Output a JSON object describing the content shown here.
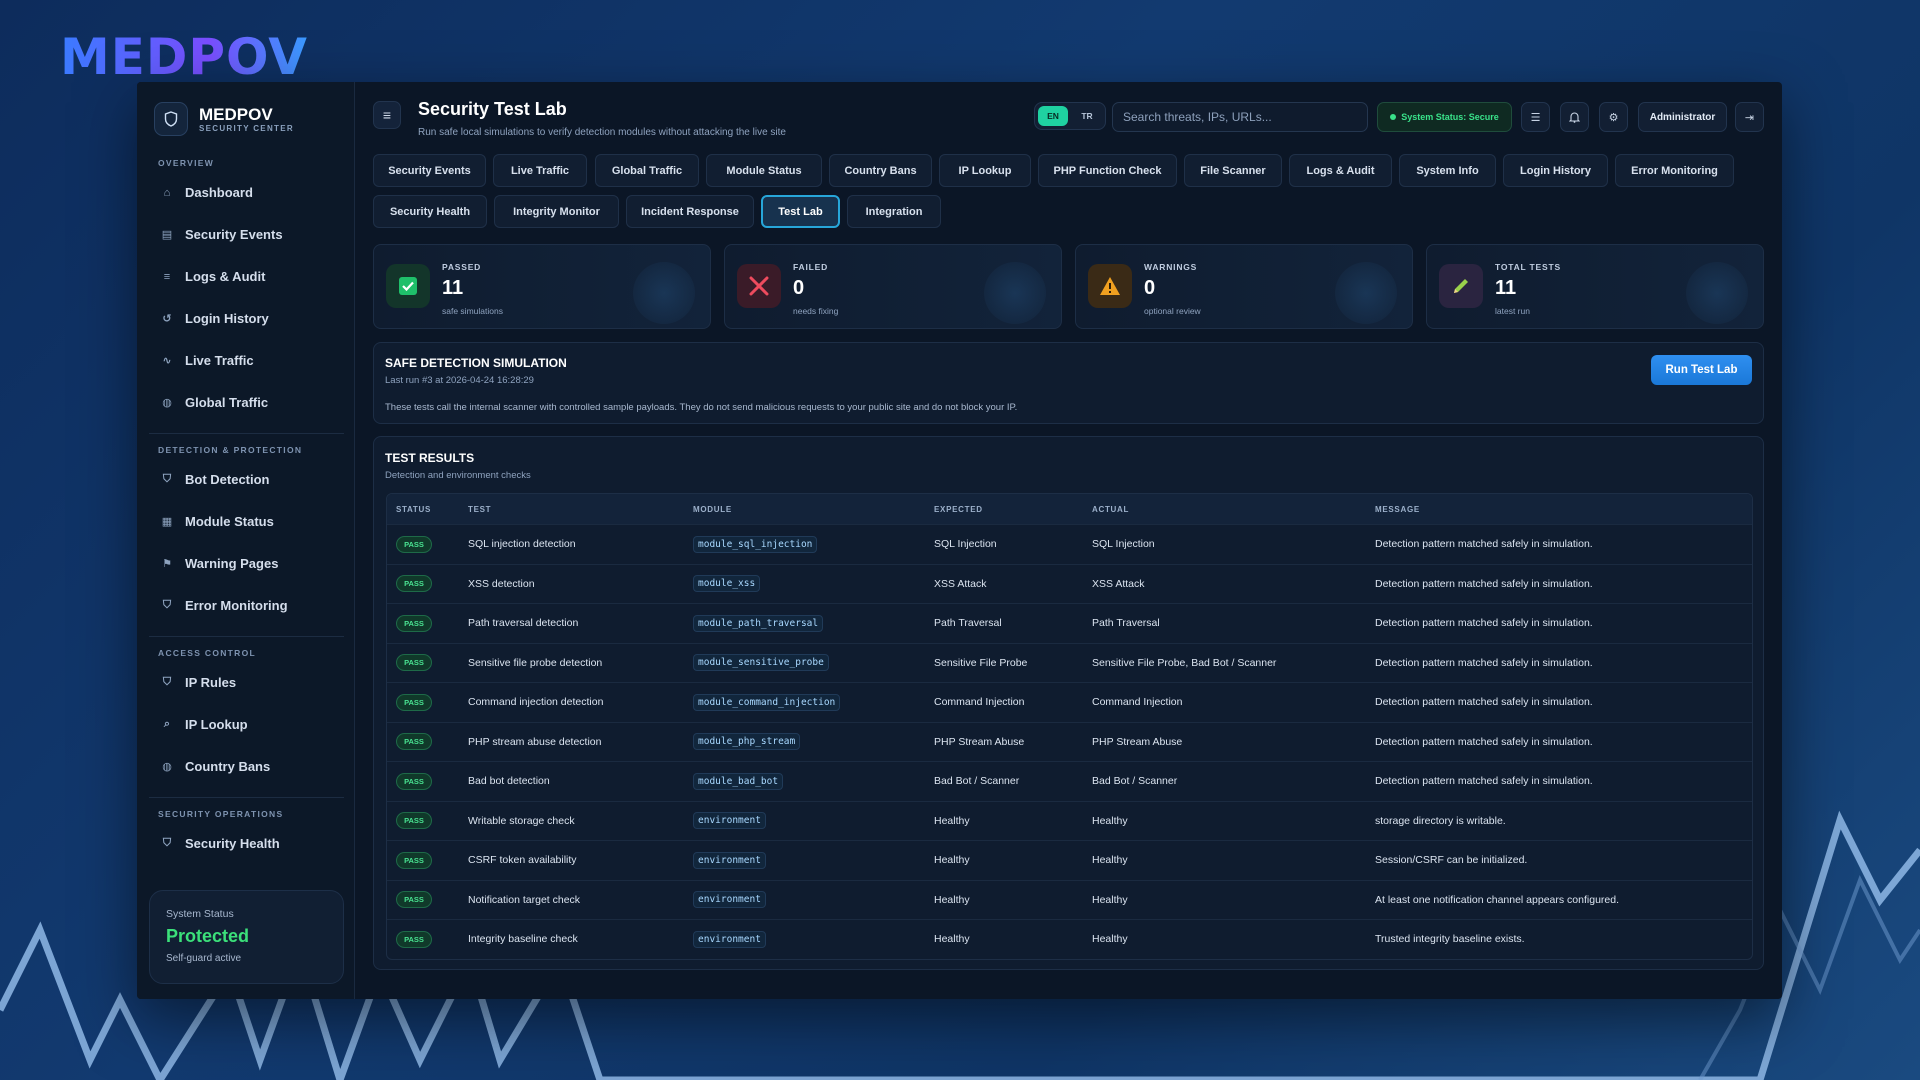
{
  "brand": {
    "logo_text": "MEDPOV",
    "name": "MEDPOV",
    "subtitle": "SECURITY CENTER"
  },
  "sidebar": {
    "sections": [
      {
        "title": "OVERVIEW"
      },
      {
        "title": "DETECTION & PROTECTION"
      },
      {
        "title": "ACCESS CONTROL"
      },
      {
        "title": "SECURITY OPERATIONS"
      }
    ],
    "items": [
      {
        "label": "Dashboard",
        "icon": "home-icon"
      },
      {
        "label": "Security Events",
        "icon": "list-icon"
      },
      {
        "label": "Logs & Audit",
        "icon": "lines-icon"
      },
      {
        "label": "Login History",
        "icon": "history-icon"
      },
      {
        "label": "Live Traffic",
        "icon": "pulse-icon"
      },
      {
        "label": "Global Traffic",
        "icon": "globe-icon"
      },
      {
        "label": "Bot Detection",
        "icon": "shield-icon"
      },
      {
        "label": "Module Status",
        "icon": "grid-icon"
      },
      {
        "label": "Warning Pages",
        "icon": "flag-icon"
      },
      {
        "label": "Error Monitoring",
        "icon": "shield-icon"
      },
      {
        "label": "IP Rules",
        "icon": "shield-icon"
      },
      {
        "label": "IP Lookup",
        "icon": "search-icon"
      },
      {
        "label": "Country Bans",
        "icon": "globe-icon"
      },
      {
        "label": "Security Health",
        "icon": "shield-icon"
      }
    ],
    "status_card": {
      "label": "System Status",
      "value": "Protected",
      "sub": "Self-guard active"
    }
  },
  "header": {
    "title": "Security Test Lab",
    "subtitle": "Run safe local simulations to verify detection modules without attacking the live site",
    "lang_en": "EN",
    "lang_tr": "TR",
    "search_placeholder": "Search threats, IPs, URLs...",
    "system_status": "System Status: Secure",
    "admin_label": "Administrator"
  },
  "tabs": [
    "Security Events",
    "Live Traffic",
    "Global Traffic",
    "Module Status",
    "Country Bans",
    "IP Lookup",
    "PHP Function Check",
    "File Scanner",
    "Logs & Audit",
    "System Info",
    "Login History",
    "Error Monitoring",
    "Security Health",
    "Integrity Monitor",
    "Incident Response",
    "Test Lab",
    "Integration"
  ],
  "active_tab": "Test Lab",
  "stats": [
    {
      "label": "PASSED",
      "value": "11",
      "sub": "safe simulations",
      "icon": "check-icon",
      "color": "#1fbf6a"
    },
    {
      "label": "FAILED",
      "value": "0",
      "sub": "needs fixing",
      "icon": "x-icon",
      "color": "#e84a5f"
    },
    {
      "label": "WARNINGS",
      "value": "0",
      "sub": "optional review",
      "icon": "warning-icon",
      "color": "#f0a020"
    },
    {
      "label": "TOTAL TESTS",
      "value": "11",
      "sub": "latest run",
      "icon": "pencil-icon",
      "color": "#9ad14b"
    }
  ],
  "simulation": {
    "title": "SAFE DETECTION SIMULATION",
    "last_run": "Last run #3 at 2026-04-24 16:28:29",
    "description": "These tests call the internal scanner with controlled sample payloads. They do not send malicious requests to your public site and do not block your IP.",
    "run_button": "Run Test Lab"
  },
  "results": {
    "title": "TEST RESULTS",
    "subtitle": "Detection and environment checks",
    "columns": [
      "STATUS",
      "TEST",
      "MODULE",
      "EXPECTED",
      "ACTUAL",
      "MESSAGE"
    ],
    "rows": [
      {
        "status": "PASS",
        "test": "SQL injection detection",
        "module": "module_sql_injection",
        "expected": "SQL Injection",
        "actual": "SQL Injection",
        "message": "Detection pattern matched safely in simulation."
      },
      {
        "status": "PASS",
        "test": "XSS detection",
        "module": "module_xss",
        "expected": "XSS Attack",
        "actual": "XSS Attack",
        "message": "Detection pattern matched safely in simulation."
      },
      {
        "status": "PASS",
        "test": "Path traversal detection",
        "module": "module_path_traversal",
        "expected": "Path Traversal",
        "actual": "Path Traversal",
        "message": "Detection pattern matched safely in simulation."
      },
      {
        "status": "PASS",
        "test": "Sensitive file probe detection",
        "module": "module_sensitive_probe",
        "expected": "Sensitive File Probe",
        "actual": "Sensitive File Probe, Bad Bot / Scanner",
        "message": "Detection pattern matched safely in simulation."
      },
      {
        "status": "PASS",
        "test": "Command injection detection",
        "module": "module_command_injection",
        "expected": "Command Injection",
        "actual": "Command Injection",
        "message": "Detection pattern matched safely in simulation."
      },
      {
        "status": "PASS",
        "test": "PHP stream abuse detection",
        "module": "module_php_stream",
        "expected": "PHP Stream Abuse",
        "actual": "PHP Stream Abuse",
        "message": "Detection pattern matched safely in simulation."
      },
      {
        "status": "PASS",
        "test": "Bad bot detection",
        "module": "module_bad_bot",
        "expected": "Bad Bot / Scanner",
        "actual": "Bad Bot / Scanner",
        "message": "Detection pattern matched safely in simulation."
      },
      {
        "status": "PASS",
        "test": "Writable storage check",
        "module": "environment",
        "expected": "Healthy",
        "actual": "Healthy",
        "message": "storage directory is writable."
      },
      {
        "status": "PASS",
        "test": "CSRF token availability",
        "module": "environment",
        "expected": "Healthy",
        "actual": "Healthy",
        "message": "Session/CSRF can be initialized."
      },
      {
        "status": "PASS",
        "test": "Notification target check",
        "module": "environment",
        "expected": "Healthy",
        "actual": "Healthy",
        "message": "At least one notification channel appears configured."
      },
      {
        "status": "PASS",
        "test": "Integrity baseline check",
        "module": "environment",
        "expected": "Healthy",
        "actual": "Healthy",
        "message": "Trusted integrity baseline exists."
      }
    ]
  }
}
